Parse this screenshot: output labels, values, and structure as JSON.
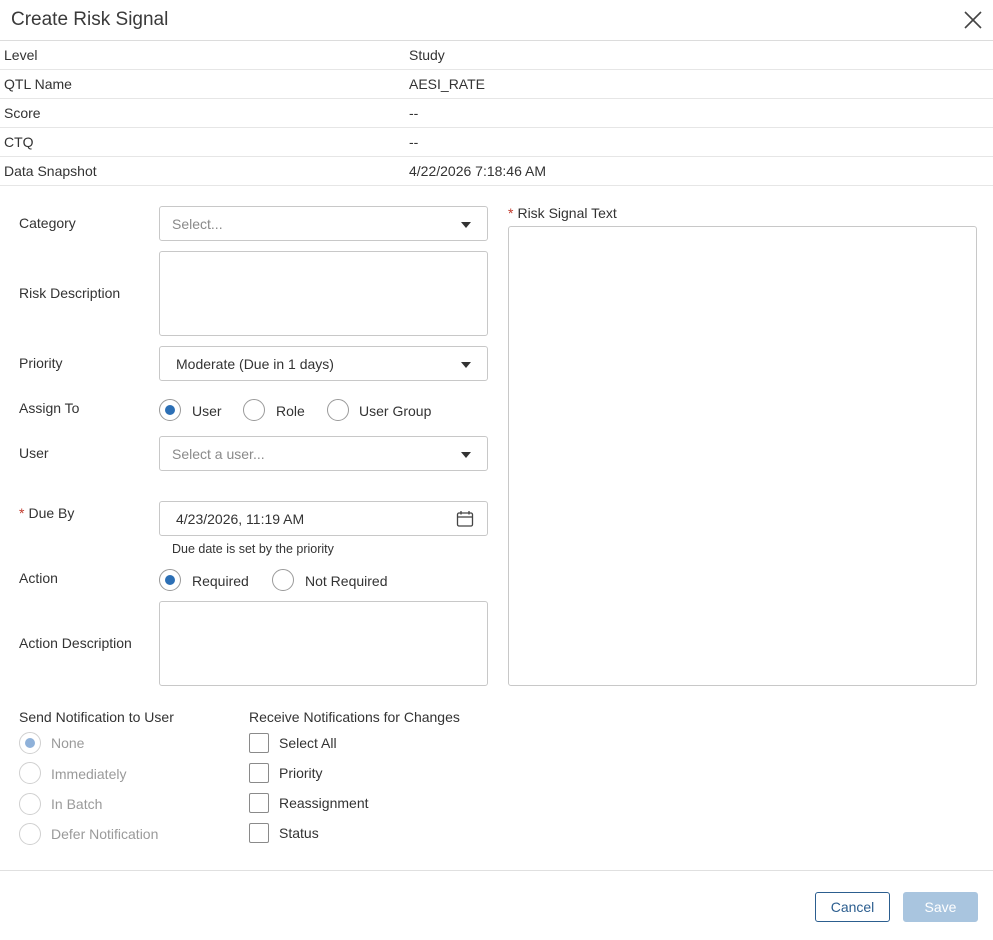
{
  "dialog": {
    "title": "Create Risk Signal"
  },
  "info": [
    {
      "label": "Level",
      "value": "Study"
    },
    {
      "label": "QTL Name",
      "value": "AESI_RATE"
    },
    {
      "label": "Score",
      "value": "--"
    },
    {
      "label": "CTQ",
      "value": "--"
    },
    {
      "label": "Data Snapshot",
      "value": "4/22/2026 7:18:46 AM"
    }
  ],
  "form": {
    "category_label": "Category",
    "category_placeholder": "Select...",
    "risk_description_label": "Risk Description",
    "priority_label": "Priority",
    "priority_value": "Moderate (Due in 1 days)",
    "assign_to_label": "Assign To",
    "assign_options": [
      "User",
      "Role",
      "User Group"
    ],
    "assign_selected": "User",
    "user_label": "User",
    "user_placeholder": "Select a user...",
    "due_by_label": "Due By",
    "due_by_value": "4/23/2026, 11:19 AM",
    "due_hint": "Due date is set by the priority",
    "action_label": "Action",
    "action_options": [
      "Required",
      "Not Required"
    ],
    "action_selected": "Required",
    "action_description_label": "Action Description",
    "risk_signal_text_label": "Risk Signal Text"
  },
  "notification": {
    "send_label": "Send Notification to User",
    "send_options": [
      "None",
      "Immediately",
      "In Batch",
      "Defer Notification"
    ],
    "send_selected": "None",
    "receive_label": "Receive Notifications for Changes",
    "receive_options": [
      "Select All",
      "Priority",
      "Reassignment",
      "Status"
    ]
  },
  "footer": {
    "cancel_label": "Cancel",
    "save_label": "Save"
  },
  "colors": {
    "accent": "#2c6fb5",
    "required": "#c0392b",
    "save_disabled": "#a9c5df",
    "cancel_border": "#2c5e8f"
  }
}
